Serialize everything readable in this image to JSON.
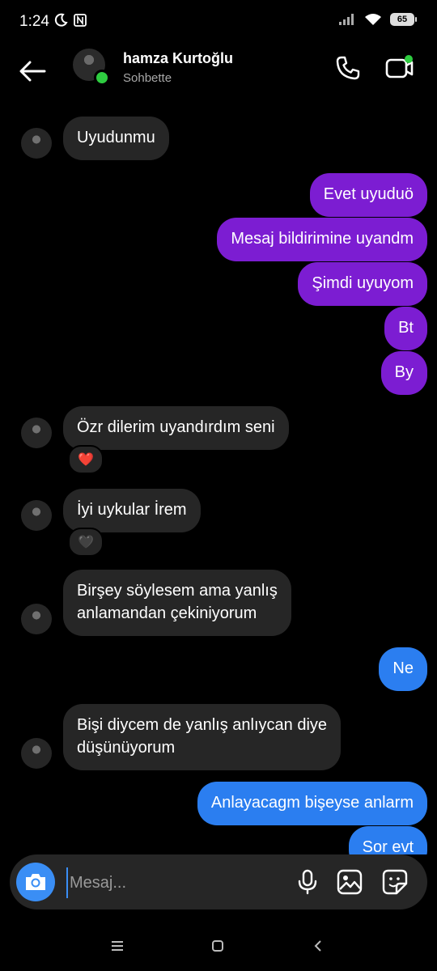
{
  "status_bar": {
    "time": "1:24",
    "battery": "65"
  },
  "header": {
    "name": "hamza Kurtoğlu",
    "status": "Sohbette"
  },
  "messages": [
    {
      "text": "Uyudunmu"
    },
    {
      "text": "Evet uyuduö"
    },
    {
      "text": "Mesaj bildirimine uyandm"
    },
    {
      "text": "Şimdi uyuyom"
    },
    {
      "text": "Bt"
    },
    {
      "text": "By"
    },
    {
      "text": "Özr dilerim uyandırdım seni",
      "reaction": "❤️"
    },
    {
      "text": "İyi uykular İrem",
      "reaction": "🖤"
    },
    {
      "line1": "Birşey söylesem ama yanlış",
      "line2": "anlamandan çekiniyorum"
    },
    {
      "text": "Ne"
    },
    {
      "line1": "Bişi diycem de yanlış anlıycan diye",
      "line2": "düşünüyorum"
    },
    {
      "text": "Anlayacagm bişeyse anlarm"
    },
    {
      "text": "Sor evt"
    }
  ],
  "composer": {
    "placeholder": "Mesaj..."
  },
  "colors": {
    "purple": "#7c1dd2",
    "blue": "#2b7ef0",
    "incoming": "#262626",
    "online": "#2ecc40"
  }
}
